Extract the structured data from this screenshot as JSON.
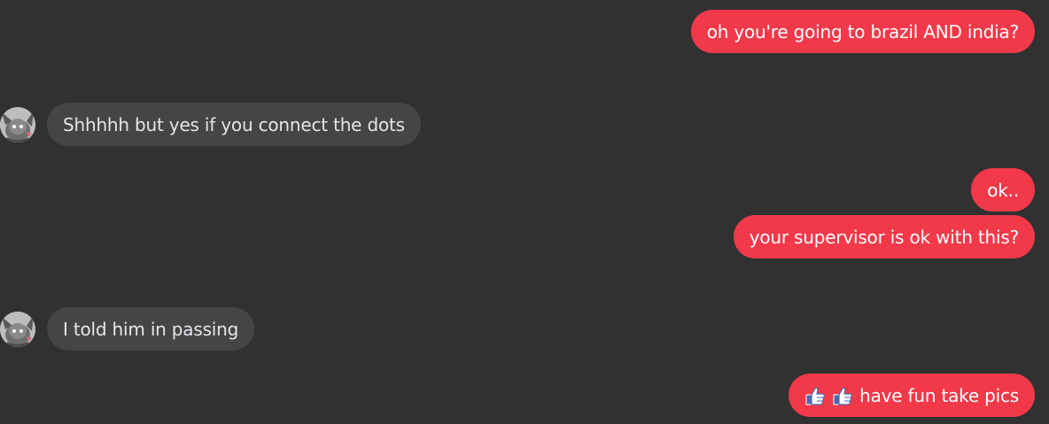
{
  "conversation": {
    "messages": [
      {
        "direction": "outgoing",
        "text": "oh you're going to brazil AND india?"
      },
      {
        "direction": "incoming",
        "text": "Shhhhh but yes if you connect the dots",
        "avatar_icon": "profile-avatar"
      },
      {
        "direction": "outgoing",
        "text": "ok.."
      },
      {
        "direction": "outgoing",
        "text": "your supervisor is ok with this?"
      },
      {
        "direction": "incoming",
        "text": "I told him in passing",
        "avatar_icon": "profile-avatar"
      },
      {
        "direction": "outgoing",
        "text": "have fun take pics",
        "leading_icons": [
          "thumbs-up-icon",
          "thumbs-up-icon"
        ]
      }
    ]
  },
  "colors": {
    "background": "#313131",
    "outgoing_bubble": "#f2394a",
    "incoming_bubble": "#454545",
    "incoming_text": "#e4e6eb",
    "outgoing_text": "#ffffff"
  }
}
